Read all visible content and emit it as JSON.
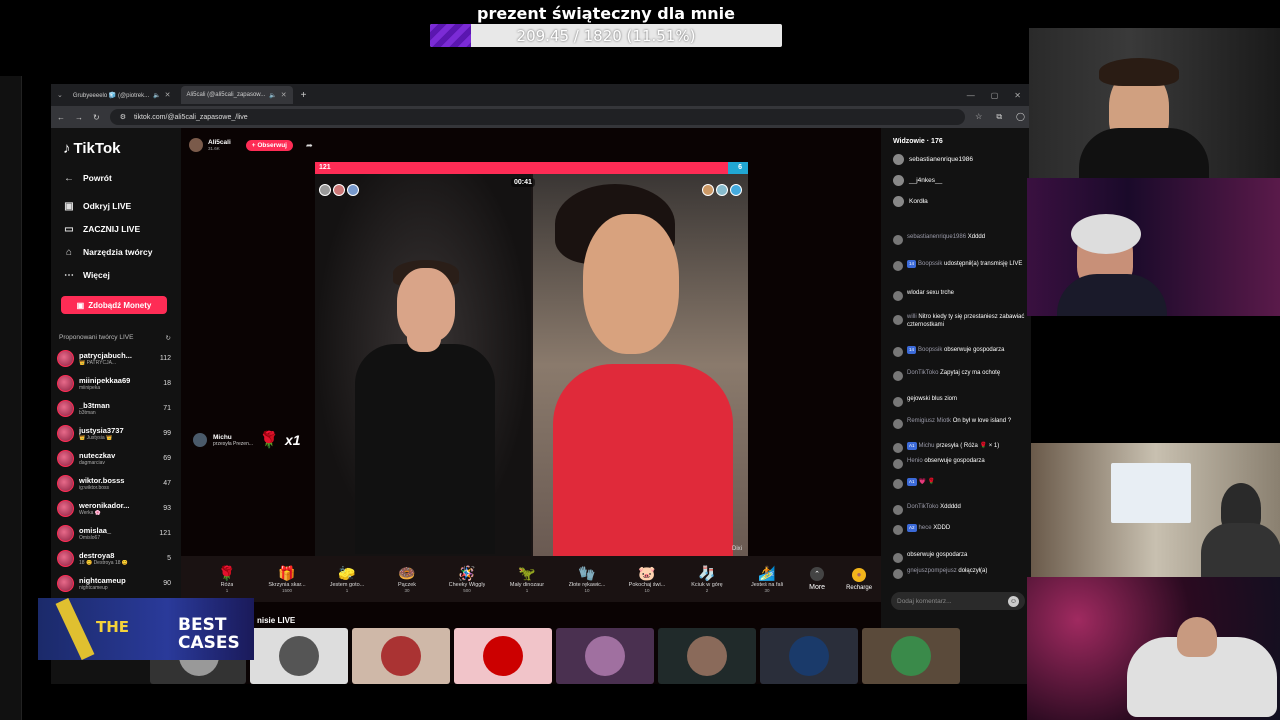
{
  "goal": {
    "title": "prezent świąteczny dla mnie",
    "progress_text": "209.45 / 1820 (11.51%)",
    "current": 209.45,
    "target": 1820,
    "percent": 11.51,
    "fill_color": "#7b2bd6"
  },
  "browser": {
    "tabs": [
      {
        "label": "Grubyeeeelo 🧊 (@piotrek...",
        "active": false
      },
      {
        "label": "Ali5cali (@ali5cali_zapasow...",
        "active": true
      }
    ],
    "url": "tiktok.com/@ali5cali_zapasowe_/live"
  },
  "sidebar": {
    "logo": "TikTok",
    "back": "Powrót",
    "nav": [
      "Odkryj LIVE",
      "ZACZNIJ LIVE",
      "Narzędzia twórcy",
      "Więcej"
    ],
    "coins_button": "Zdobądź Monety",
    "suggested_header": "Proponowani twórcy LIVE",
    "creators": [
      {
        "name": "patrycjabuch...",
        "sub": "👑 PATRYCJA...",
        "count": "112"
      },
      {
        "name": "miinipekkaa69",
        "sub": "miinipeka",
        "count": "18"
      },
      {
        "name": "_b3tman",
        "sub": "b3tman",
        "count": "71"
      },
      {
        "name": "justysia3737",
        "sub": "👑 Justysia 👑",
        "count": "99"
      },
      {
        "name": "nuteczkav",
        "sub": "dagmarciav",
        "count": "69"
      },
      {
        "name": "wiktor.bosss",
        "sub": "ig:wiktor.boss",
        "count": "47"
      },
      {
        "name": "weronikador...",
        "sub": "Werka 🌸",
        "count": "93"
      },
      {
        "name": "omislaa_",
        "sub": "Omislo67",
        "count": "121"
      },
      {
        "name": "destroya8",
        "sub": "18 😊 Destroya 18 😊",
        "count": "5"
      },
      {
        "name": "nightcameup",
        "sub": "nightcameup",
        "count": "90"
      }
    ]
  },
  "live": {
    "host_name": "Ali5cali",
    "host_sub": "31.6K",
    "follow": "+ Obserwuj",
    "score_left": "121",
    "score_right": "6",
    "timer": "00:41",
    "streamer_tag": "Dixi",
    "gift_toast": {
      "name": "Michu",
      "action": "przesyła Prezen...",
      "multiplier": "x1"
    }
  },
  "gifts": [
    {
      "icon": "🌹",
      "name": "Róża",
      "price": "1"
    },
    {
      "icon": "🎁",
      "name": "Skrzynia skar...",
      "price": "1500"
    },
    {
      "icon": "🧽",
      "name": "Jestem goto...",
      "price": "1"
    },
    {
      "icon": "🍩",
      "name": "Pączek",
      "price": "30"
    },
    {
      "icon": "🪅",
      "name": "Cheeky Wiggly",
      "price": "500"
    },
    {
      "icon": "🦖",
      "name": "Mały dinozaur",
      "price": "1"
    },
    {
      "icon": "🧤",
      "name": "Złote rękawic...",
      "price": "10"
    },
    {
      "icon": "🐷",
      "name": "Pokochaj świ...",
      "price": "10"
    },
    {
      "icon": "🧦",
      "name": "Kciuk w górę",
      "price": "2"
    },
    {
      "icon": "🏄",
      "name": "Jesteś na fali",
      "price": "30"
    }
  ],
  "gift_more": "More",
  "recharge": "Recharge",
  "lower_title": "nisie LIVE",
  "chat": {
    "viewers_header": "Widzowie · 176",
    "viewers": [
      "sebastianenrique1986",
      "__j4nkes__",
      "Kordła"
    ],
    "messages": [
      {
        "name": "sebastianenrique1986",
        "badge": "",
        "text": "Xdddd"
      },
      {
        "name": "Boopssik",
        "badge": "14",
        "text": "udostępnił(a) transmisję LIVE"
      },
      {
        "name": "",
        "badge": "",
        "text": "wlodar sexu trche"
      },
      {
        "name": "willi",
        "badge": "",
        "text": "Nitro kiedy ty się przestaniesz zabawiać czternostkami"
      },
      {
        "name": "Boopssik",
        "badge": "14",
        "text": "obserwuje gospodarza"
      },
      {
        "name": "DonTikToko",
        "badge": "",
        "text": "Zapytaj czy ma ochotę"
      },
      {
        "name": "",
        "badge": "",
        "text": "gejowski blus ziom"
      },
      {
        "name": "Remigiusz Miotk",
        "badge": "",
        "text": "On był w love island ?"
      },
      {
        "name": "Michu",
        "badge": "A1",
        "text": "przesyła ( Róża 🌹 × 1)"
      },
      {
        "name": "Henio",
        "badge": "",
        "text": "obserwuje gospodarza"
      },
      {
        "name": "",
        "badge": "A1",
        "text": "💗 🌹"
      },
      {
        "name": "DonTikToko",
        "badge": "",
        "text": "Xddddd"
      },
      {
        "name": "hece",
        "badge": "A2",
        "text": "XDDD"
      },
      {
        "name": "",
        "badge": "",
        "text": "obserwuje gospodarza"
      },
      {
        "name": "gnejuszpompejusz",
        "badge": "",
        "text": "dołączył(a)"
      }
    ],
    "input_placeholder": "Dodaj komentarz...",
    "emoji_icon": "smile-icon"
  },
  "promo": {
    "word1": "THE",
    "word2": "BEST",
    "word3": "CASES"
  }
}
